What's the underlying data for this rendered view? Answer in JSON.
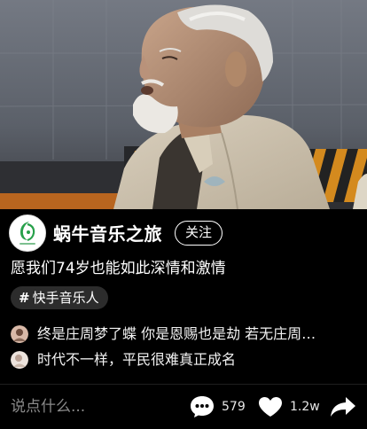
{
  "video": {
    "description_icon": "video-frame"
  },
  "author": {
    "name": "蜗牛音乐之旅",
    "avatar_icon": "snail-music-logo"
  },
  "follow_label": "关注",
  "caption": "愿我们74岁也能如此深情和激情",
  "tag": {
    "symbol": "#",
    "label": "快手音乐人"
  },
  "comments": [
    {
      "text": "终是庄周梦了蝶 你是恩赐也是劫 若无庄周…"
    },
    {
      "text": "时代不一样，平民很难真正成名"
    }
  ],
  "action_bar": {
    "comment_placeholder": "说点什么...",
    "comment_count": "579",
    "like_count": "1.2w",
    "icons": {
      "comment": "speech-bubble-icon",
      "like": "heart-icon",
      "share": "share-arrow-icon"
    }
  },
  "colors": {
    "background": "#000000",
    "tag_bg": "#2c2c2c",
    "placeholder": "#8a8a8a",
    "logo_green": "#27a04a"
  }
}
